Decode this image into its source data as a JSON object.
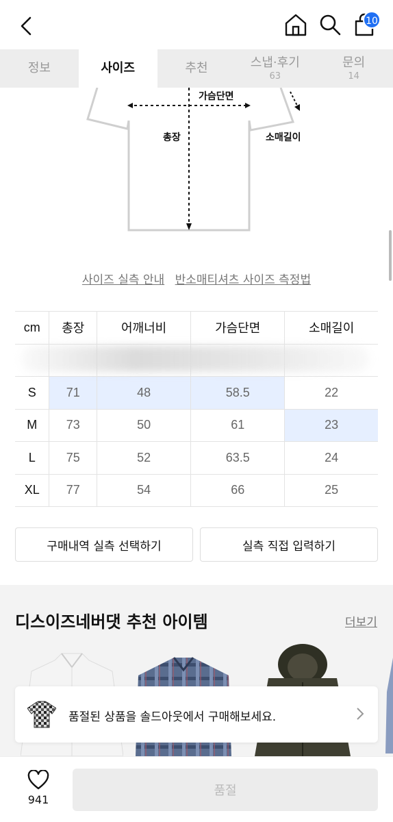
{
  "header": {
    "cart_count": "10"
  },
  "tabs": [
    {
      "label": "정보",
      "count": ""
    },
    {
      "label": "사이즈",
      "count": ""
    },
    {
      "label": "추천",
      "count": ""
    },
    {
      "label": "스냅·후기",
      "count": "63"
    },
    {
      "label": "문의",
      "count": "14"
    }
  ],
  "diagram": {
    "chest": "가슴단면",
    "length": "총장",
    "sleeve": "소매길이"
  },
  "links": {
    "guide": "사이즈 실측 안내",
    "method": "반소매티셔츠 사이즈 측정법"
  },
  "size_table": {
    "headers": [
      "cm",
      "총장",
      "어깨너비",
      "가슴단면",
      "소매길이"
    ],
    "rows": [
      [
        "S",
        "71",
        "48",
        "58.5",
        "22"
      ],
      [
        "M",
        "73",
        "50",
        "61",
        "23"
      ],
      [
        "L",
        "75",
        "52",
        "63.5",
        "24"
      ],
      [
        "XL",
        "77",
        "54",
        "66",
        "25"
      ]
    ],
    "highlight_color": "#e6efff"
  },
  "buttons": {
    "history": "구매내역 실측 선택하기",
    "manual": "실측 직접 입력하기"
  },
  "recommend": {
    "title": "디스이즈네버댓 추천 아이템",
    "more": "더보기"
  },
  "soldout_banner": {
    "text": "품절된 상품을 솔드아웃에서 구매해보세요."
  },
  "bottom": {
    "likes": "941",
    "buy_label": "품절"
  },
  "colors": {
    "accent": "#1f6ff3"
  }
}
